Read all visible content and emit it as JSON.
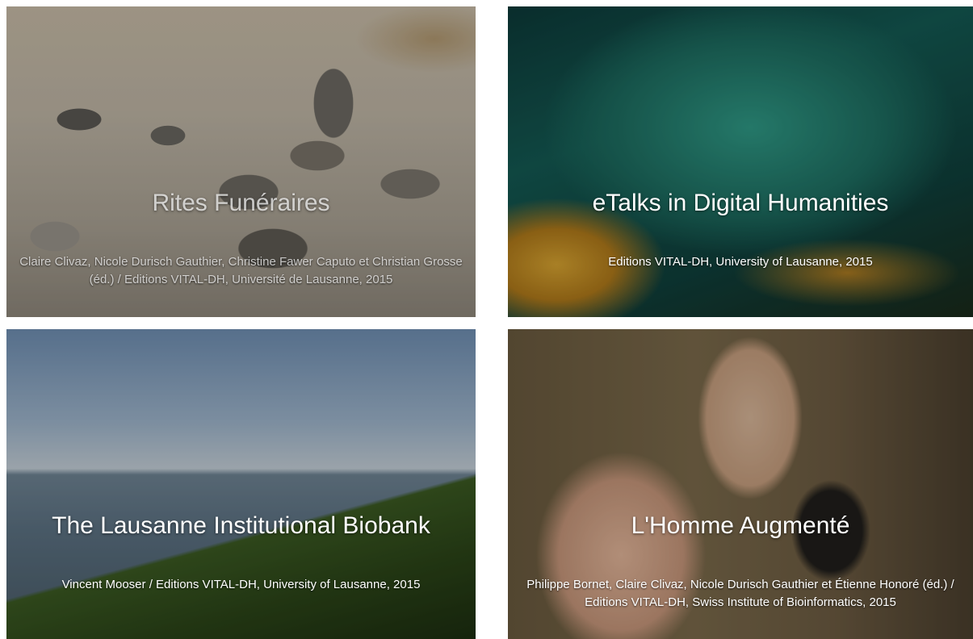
{
  "tiles": [
    {
      "title": "Rites Funéraires",
      "credit": "Claire Clivaz, Nicole Durisch Gauthier, Christine Fawer Caputo et Christian Grosse (éd.) / Editions VITAL-DH, Université de Lausanne, 2015"
    },
    {
      "title": "eTalks in Digital Humanities",
      "credit": "Editions VITAL-DH, University of Lausanne, 2015"
    },
    {
      "title": "The Lausanne Institutional Biobank",
      "credit": "Vincent Mooser / Editions VITAL-DH, University of Lausanne, 2015"
    },
    {
      "title": "L'Homme Augmenté",
      "credit": "Philippe Bornet, Claire Clivaz, Nicole Durisch Gauthier et Étienne Honoré (éd.) / Editions VITAL-DH, Swiss Institute of Bioinformatics, 2015"
    }
  ]
}
